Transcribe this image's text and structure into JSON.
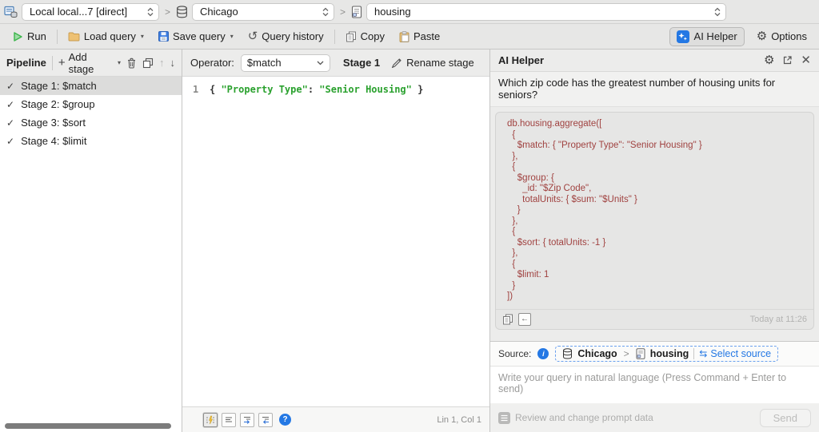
{
  "icons": {
    "breadcrumb_sep": ">",
    "menu_caret": "▾",
    "check": "✓",
    "history": "↺",
    "gear": "⚙",
    "close": "✕",
    "up": "↑",
    "down": "↓",
    "plus": "+",
    "help": "?",
    "info": "i",
    "insert": "←",
    "swap": "⇆"
  },
  "topbar": {
    "connection": "Local local...7 [direct]",
    "database": "Chicago",
    "collection": "housing"
  },
  "toolbar": {
    "run": "Run",
    "load_query": "Load query",
    "save_query": "Save query",
    "query_history": "Query history",
    "copy": "Copy",
    "paste": "Paste",
    "ai_helper": "AI Helper",
    "options": "Options"
  },
  "pipeline": {
    "title": "Pipeline",
    "add_stage": "Add stage",
    "stages": [
      {
        "label": "Stage 1: $match",
        "checked": true,
        "selected": true
      },
      {
        "label": "Stage 2: $group",
        "checked": true,
        "selected": false
      },
      {
        "label": "Stage 3: $sort",
        "checked": true,
        "selected": false
      },
      {
        "label": "Stage 4: $limit",
        "checked": true,
        "selected": false
      }
    ]
  },
  "editor": {
    "operator_label": "Operator:",
    "operator_value": "$match",
    "stage_title": "Stage 1",
    "rename_stage": "Rename stage",
    "line_number": "1",
    "code": {
      "open": "{ ",
      "key": "\"Property Type\"",
      "colon": ": ",
      "value": "\"Senior Housing\"",
      "close": " }"
    },
    "status": "Lin 1, Col 1"
  },
  "ai": {
    "title": "AI Helper",
    "question": "Which zip code has the greatest number of housing units for seniors?",
    "code": "db.housing.aggregate([\n  {\n    $match: { \"Property Type\": \"Senior Housing\" }\n  },\n  {\n    $group: {\n      _id: \"$Zip Code\",\n      totalUnits: { $sum: \"$Units\" }\n    }\n  },\n  {\n    $sort: { totalUnits: -1 }\n  },\n  {\n    $limit: 1\n  }\n])",
    "timestamp": "Today at 11:26",
    "source_label": "Source:",
    "source_database": "Chicago",
    "source_collection": "housing",
    "select_source": "Select source",
    "placeholder": "Write your query in natural language (Press Command + Enter to send)",
    "review": "Review and change prompt data",
    "send": "Send"
  },
  "colors": {
    "accent_blue": "#2478e4",
    "code_green": "#2aa12e",
    "ai_code_red": "#a04240",
    "run_green": "#3bb54a"
  }
}
